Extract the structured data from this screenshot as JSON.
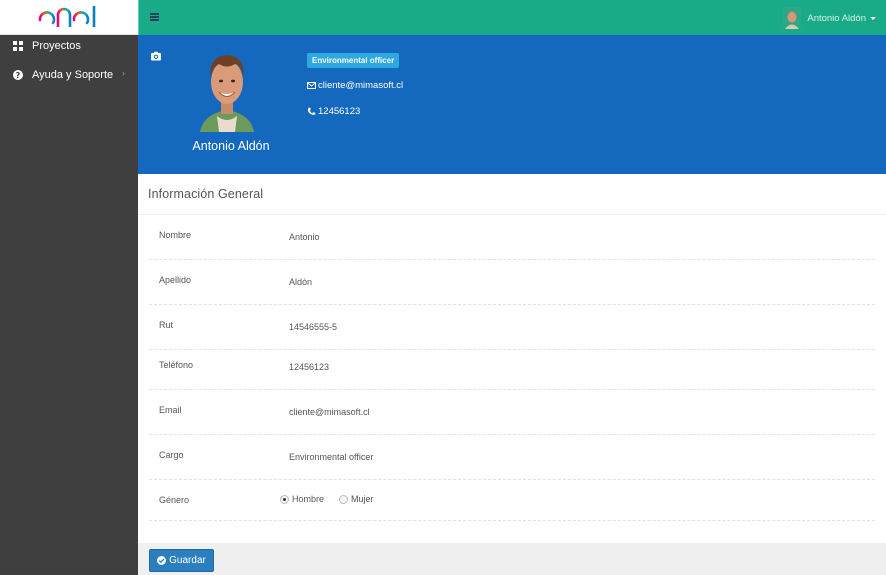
{
  "brand": {
    "logo_text": "enel"
  },
  "topbar": {
    "user_name": "Antonio Aldón"
  },
  "sidebar": {
    "items": [
      {
        "label": "Proyectos",
        "icon": "grid-icon"
      },
      {
        "label": "Ayuda y Soporte",
        "icon": "question-circle-icon"
      }
    ]
  },
  "profile": {
    "name": "Antonio Aldón",
    "role_badge": "Environmental officer",
    "email": "cliente@mimasoft.cl",
    "phone": "12456123"
  },
  "info": {
    "title": "Información General",
    "fields": [
      {
        "label": "Nombre",
        "value": "Antonio"
      },
      {
        "label": "Apellido",
        "value": "Aldón"
      },
      {
        "label": "Rut",
        "value": "14546555-5"
      },
      {
        "label": "Teléfono",
        "value": "12456123"
      },
      {
        "label": "Email",
        "value": "cliente@mimasoft.cl"
      },
      {
        "label": "Cargo",
        "value": "Environmental officer"
      }
    ],
    "gender": {
      "label": "Género",
      "options": [
        "Hombre",
        "Mujer"
      ],
      "selected": "Hombre"
    }
  },
  "actions": {
    "save_label": "Guardar"
  },
  "colors": {
    "topbar": "#19aa87",
    "header": "#1469be",
    "sidebar": "#3f3f3f",
    "badge": "#2ea8e0",
    "save_button": "#2b7fbf"
  }
}
